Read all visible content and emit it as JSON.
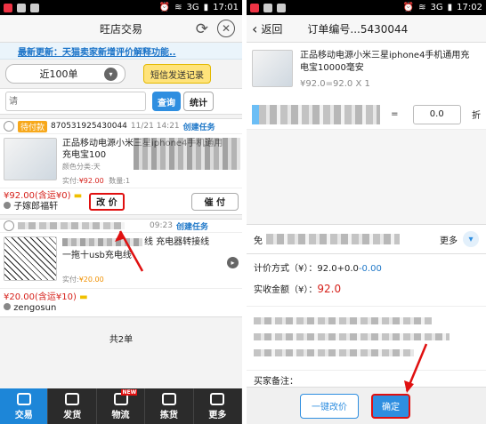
{
  "left": {
    "status": {
      "time": "17:01",
      "signal": "3G"
    },
    "title": "旺店交易",
    "announcement": "最新更新：天猫卖家新增评价解释功能..",
    "filter": {
      "range": "近100单",
      "sms_button": "短信发送记录"
    },
    "search": {
      "placeholder": "请",
      "query_button": "查询",
      "stats_button": "统计"
    },
    "orders": [
      {
        "status": "待付款",
        "order_no": "870531925430044",
        "time": "11/21 14:21",
        "action": "创建任务",
        "title_line1": "正品移动电源小米三星iphone4手机通用",
        "title_line2": "充电宝100",
        "spec": "颜色分类:天",
        "paid_label": "实付:",
        "paid_value": "¥92.00",
        "qty": "数量:1",
        "total": "¥92.00(含运¥0)",
        "buyer": "子嫁郎福轩",
        "btn_change": "改 价",
        "btn_remind": "催 付"
      },
      {
        "time": "09:23",
        "action": "创建任务",
        "title_line1": "线 充电器转接线",
        "title_line2": "一拖十usb充电线",
        "paid_label": "实付:",
        "paid_value": "¥20.00",
        "total": "¥20.00(含运¥10)",
        "buyer": "zengosun"
      }
    ],
    "count_text": "共2单",
    "tabs": [
      "交易",
      "发货",
      "物流",
      "拣货",
      "更多"
    ],
    "new_badge": "NEW"
  },
  "right": {
    "status": {
      "time": "17:02",
      "signal": "3G"
    },
    "back": "返回",
    "title": "订单编号...5430044",
    "product": {
      "title": "正品移动电源小米三星iphone4手机通用充电宝10000毫安",
      "price_line": "¥92.0=92.0 X 1"
    },
    "discount": {
      "equals": "=",
      "value": "0.0",
      "unit": "折"
    },
    "free_label": "免",
    "more": "更多",
    "calc": {
      "label": "计价方式（¥）：",
      "value_a": "92.0+0.0",
      "value_b": "-0.00"
    },
    "actual": {
      "label": "实收金额（¥）：",
      "value": "92.0"
    },
    "remark_label": "买家备注：",
    "btn_oneclick": "一键改价",
    "btn_confirm": "确定",
    "colors": {
      "accent": "#2e8ee0",
      "red": "#d6211b",
      "highlight": "#e01010"
    }
  }
}
